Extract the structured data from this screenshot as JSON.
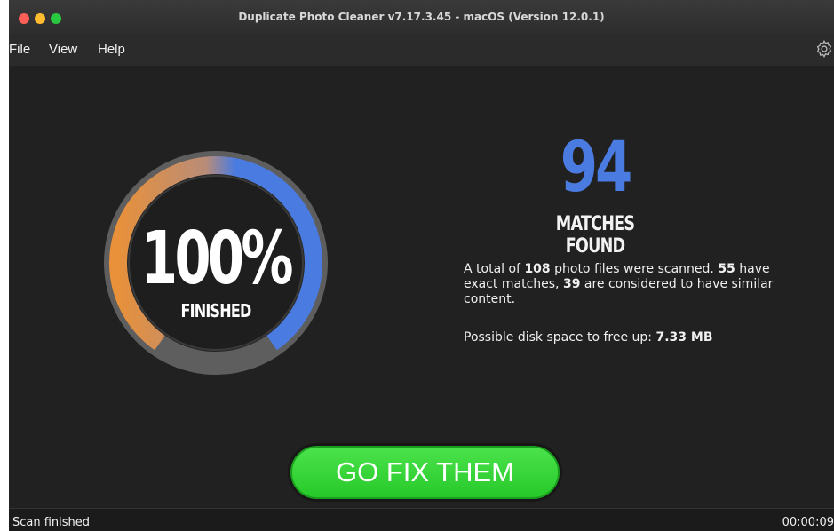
{
  "window": {
    "title": "Duplicate Photo Cleaner v7.17.3.45 - macOS (Version 12.0.1)"
  },
  "menu": {
    "items": [
      "File",
      "View",
      "Help"
    ],
    "settings_icon": "gear-icon"
  },
  "progress": {
    "percent_label": "100%",
    "status_label": "FINISHED",
    "value": 1.0,
    "colors": {
      "start": "#e8913a",
      "end": "#4a7be0",
      "track": "#6a6a6a"
    }
  },
  "results": {
    "matches_count": "94",
    "matches_label": "MATCHES FOUND",
    "summary": {
      "p1": "A total of ",
      "total_files": "108",
      "p2": " photo files were scanned. ",
      "exact": "55",
      "p3": " have exact matches, ",
      "similar": "39",
      "p4": " are considered to have similar content."
    },
    "free_up_label": "Possible disk space to free up: ",
    "free_up_value": "7.33 MB"
  },
  "action": {
    "button_label": "GO FIX THEM",
    "color": "#2fd12f"
  },
  "status_bar": {
    "text": "Scan finished",
    "elapsed": "00:00:09"
  }
}
